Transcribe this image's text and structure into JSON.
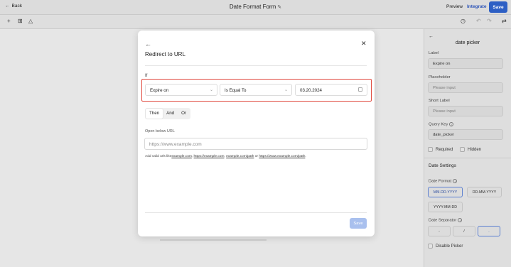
{
  "header": {
    "back_label": "Back",
    "title": "Date Format Form",
    "preview_label": "Preview",
    "integrate_label": "Integrate",
    "save_label": "Save"
  },
  "modal": {
    "title": "Redirect to URL",
    "if_label": "If",
    "condition": {
      "field": "Expire on",
      "operator": "Is Equal To",
      "value": "03.20.2024"
    },
    "logic_tabs": [
      "Then",
      "And",
      "Or"
    ],
    "active_tab": "Then",
    "url_label": "Open below URL",
    "url_placeholder": "https://www.example.com",
    "hint_prefix": "Add valid urls like",
    "hint_links": [
      "example.com",
      "https://example.com",
      "example.com/path",
      "https://www.example.com/path"
    ],
    "hint_sep_1": ",",
    "hint_sep_2": ",",
    "hint_or": "or",
    "hint_suffix": ".",
    "save_label": "Save",
    "colors": {
      "highlight": "#e0493e",
      "save_disabled": "#a9c0ee"
    }
  },
  "right_panel": {
    "title": "date picker",
    "label_label": "Label",
    "label_value": "Expire on",
    "placeholder_label": "Placeholder",
    "placeholder_placeholder": "Please input",
    "short_label_label": "Short Label",
    "short_label_placeholder": "Please input",
    "query_key_label": "Query Key",
    "query_key_value": "date_picker",
    "required_label": "Required",
    "hidden_label": "Hidden",
    "date_settings_title": "Date Settings",
    "date_format_label": "Date Format",
    "date_formats": [
      "MM-DD-YYYY",
      "DD-MM-YYYY",
      "YYYY-MM-DD"
    ],
    "selected_format": "MM-DD-YYYY",
    "date_separator_label": "Date Separator",
    "separators": [
      "-",
      "/",
      "."
    ],
    "disable_picker_label": "Disable Picker"
  }
}
